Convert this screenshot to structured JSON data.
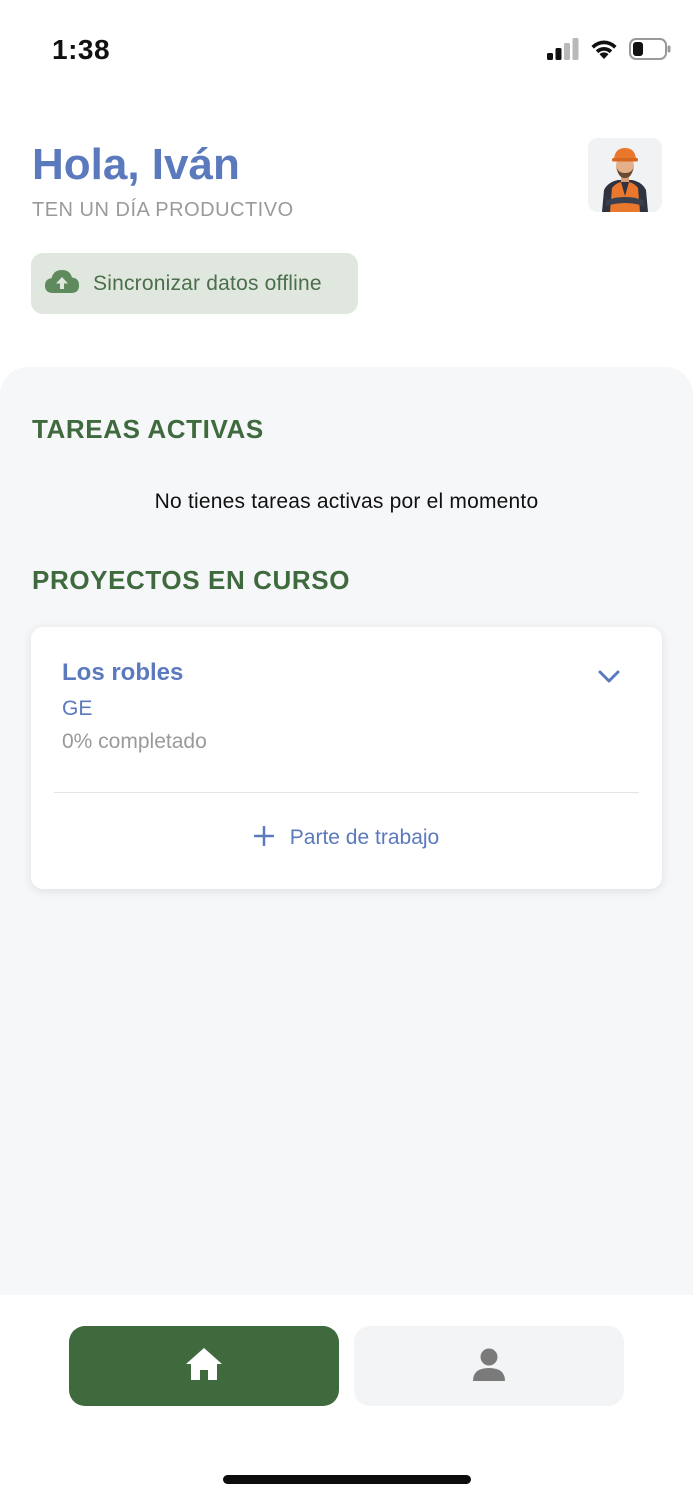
{
  "status_bar": {
    "time": "1:38"
  },
  "header": {
    "greeting": "Hola, Iván",
    "subtitle": "TEN UN DÍA PRODUCTIVO",
    "sync_button_label": "Sincronizar datos offline"
  },
  "tasks": {
    "title": "TAREAS ACTIVAS",
    "empty_message": "No tienes tareas activas por el momento"
  },
  "projects": {
    "title": "PROYECTOS EN CURSO",
    "items": [
      {
        "name": "Los robles",
        "code": "GE",
        "progress": "0% completado",
        "add_action_label": "Parte de trabajo"
      }
    ]
  },
  "bottom_nav": {
    "items": [
      {
        "icon": "home-icon",
        "active": true
      },
      {
        "icon": "user-icon",
        "active": false
      }
    ]
  },
  "colors": {
    "primary_blue": "#5b79bd",
    "primary_green": "#3e6a3d",
    "sync_bg": "#dfe7df",
    "panel_bg": "#f6f7f9",
    "muted_text": "#9a9a9a"
  }
}
